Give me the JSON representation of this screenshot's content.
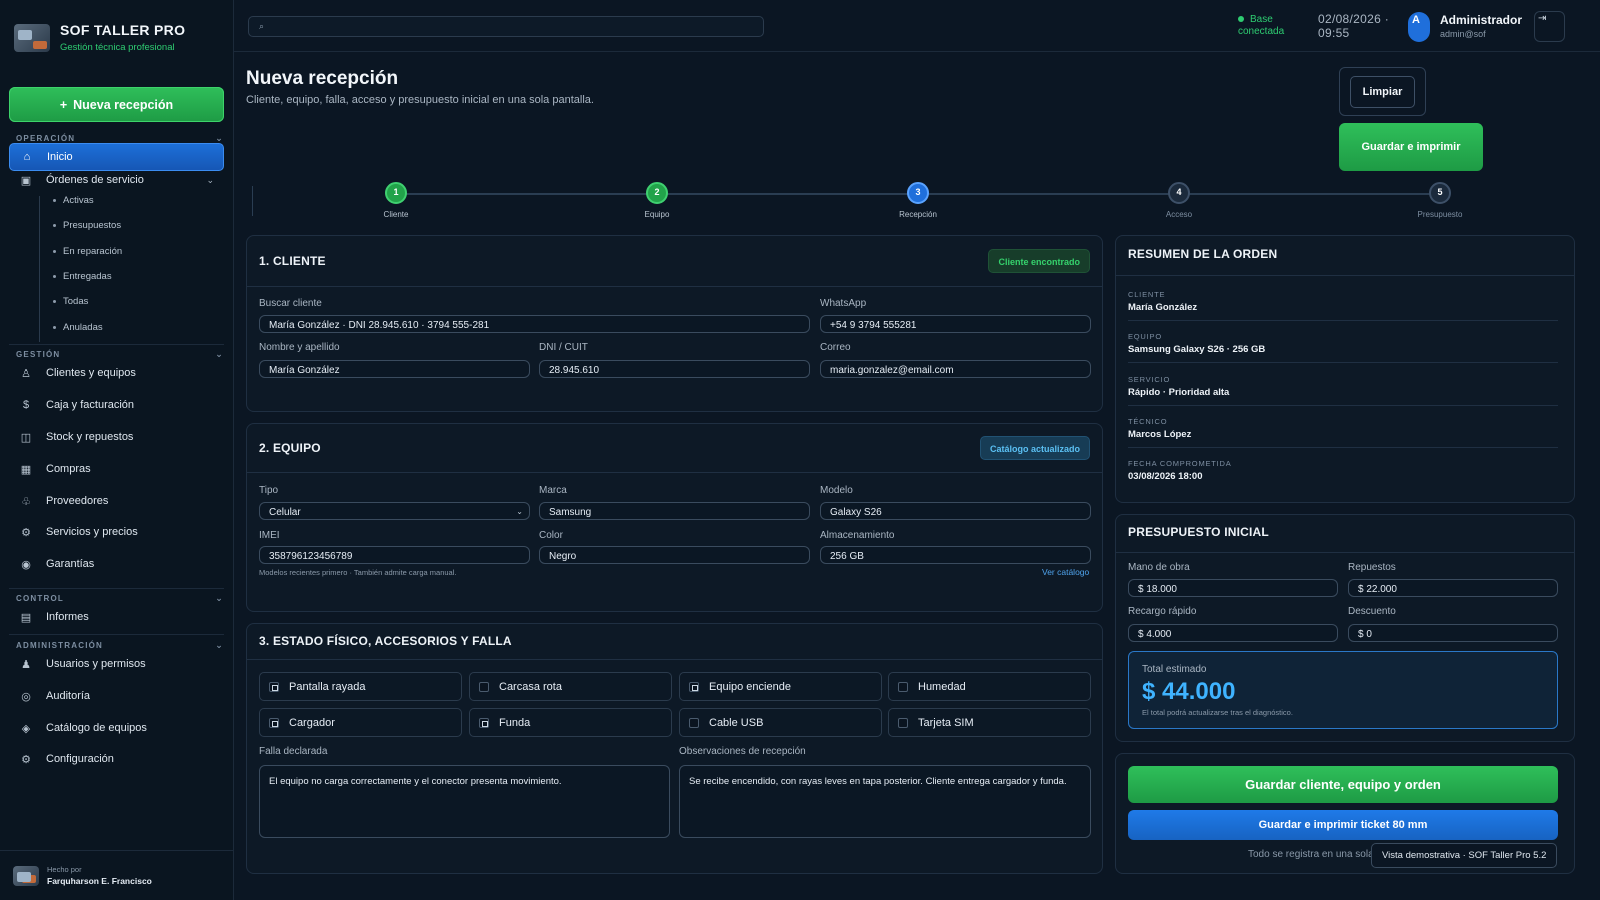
{
  "brand": {
    "title": "SOF TALLER PRO",
    "subtitle": "Gestión técnica profesional"
  },
  "sidebar": {
    "new_button": "Nueva recepción",
    "new_button_icon": "+",
    "sections": {
      "operacion": "OPERACIÓN",
      "gestion": "GESTIÓN",
      "control": "CONTROL",
      "administracion": "ADMINISTRACIÓN"
    },
    "items": {
      "inicio": "Inicio",
      "ordenes": "Órdenes de servicio",
      "clientes": "Clientes y equipos",
      "caja": "Caja y facturación",
      "stock": "Stock y repuestos",
      "compras": "Compras",
      "proveedores": "Proveedores",
      "servicios": "Servicios y precios",
      "garantias": "Garantías",
      "informes": "Informes",
      "usuarios": "Usuarios y permisos",
      "auditoria": "Auditoría",
      "catalogo": "Catálogo de equipos",
      "configuracion": "Configuración"
    },
    "sub_items": [
      "Activas",
      "Presupuestos",
      "En reparación",
      "Entregadas",
      "Todas",
      "Anuladas"
    ],
    "footer": {
      "small": "Hecho por",
      "name": "Farquharson E. Francisco"
    }
  },
  "topbar": {
    "search_icon": "⌕",
    "status_line1": "Base",
    "status_line2": "conectada",
    "date": "02/08/2026 ·",
    "time": "09:55",
    "avatar": "A",
    "user_name": "Administrador",
    "user_email": "admin@sof",
    "logout_icon": "⇥"
  },
  "page": {
    "title": "Nueva recepción",
    "subtitle": "Cliente, equipo, falla, acceso y presupuesto inicial en una sola pantalla.",
    "clear_button": "Limpiar",
    "save_print_button": "Guardar e imprimir"
  },
  "stepper": {
    "steps": [
      {
        "num": "1",
        "label": "Cliente"
      },
      {
        "num": "2",
        "label": "Equipo"
      },
      {
        "num": "3",
        "label": "Recepción"
      },
      {
        "num": "4",
        "label": "Acceso"
      },
      {
        "num": "5",
        "label": "Presupuesto"
      }
    ],
    "current_step": 3
  },
  "cliente": {
    "title": "1. CLIENTE",
    "badge": "Cliente encontrado",
    "buscar_label": "Buscar cliente",
    "buscar_value": "María González · DNI 28.945.610 · 3794 555-281",
    "whatsapp_label": "WhatsApp",
    "whatsapp_value": "+54 9 3794 555281",
    "nombre_label": "Nombre y apellido",
    "nombre_value": "María González",
    "dni_label": "DNI / CUIT",
    "dni_value": "28.945.610",
    "correo_label": "Correo",
    "correo_value": "maria.gonzalez@email.com"
  },
  "equipo": {
    "title": "2. EQUIPO",
    "badge": "Catálogo actualizado",
    "tipo_label": "Tipo",
    "tipo_value": "Celular",
    "marca_label": "Marca",
    "marca_value": "Samsung",
    "modelo_label": "Modelo",
    "modelo_value": "Galaxy S26",
    "imei_label": "IMEI",
    "imei_value": "358796123456789",
    "color_label": "Color",
    "color_value": "Negro",
    "almac_label": "Almacenamiento",
    "almac_value": "256 GB",
    "hint": "Modelos recientes primero · También admite carga manual.",
    "link": "Ver catálogo"
  },
  "estado": {
    "title": "3. ESTADO FÍSICO, ACCESORIOS Y FALLA",
    "checks": [
      {
        "label": "Pantalla rayada",
        "checked": true
      },
      {
        "label": "Carcasa rota",
        "checked": false
      },
      {
        "label": "Equipo enciende",
        "checked": true
      },
      {
        "label": "Humedad",
        "checked": false
      },
      {
        "label": "Cargador",
        "checked": true
      },
      {
        "label": "Funda",
        "checked": true
      },
      {
        "label": "Cable USB",
        "checked": false
      },
      {
        "label": "Tarjeta SIM",
        "checked": false
      }
    ],
    "falla_label": "Falla declarada",
    "falla_value": "El equipo no carga correctamente y el conector presenta movimiento.",
    "obs_label": "Observaciones de recepción",
    "obs_value": "Se recibe encendido, con rayas leves en tapa posterior. Cliente entrega cargador y funda."
  },
  "resumen": {
    "title": "RESUMEN DE LA ORDEN",
    "rows": [
      {
        "key": "CLIENTE",
        "value": "María González"
      },
      {
        "key": "EQUIPO",
        "value": "Samsung Galaxy S26 · 256 GB"
      },
      {
        "key": "SERVICIO",
        "value": "Rápido · Prioridad alta"
      },
      {
        "key": "TÉCNICO",
        "value": "Marcos López"
      },
      {
        "key": "FECHA COMPROMETIDA",
        "value": "03/08/2026 18:00"
      }
    ]
  },
  "presupuesto": {
    "title": "PRESUPUESTO INICIAL",
    "mano_label": "Mano de obra",
    "mano_value": "$ 18.000",
    "repuestos_label": "Repuestos",
    "repuestos_value": "$ 22.000",
    "recargo_label": "Recargo rápido",
    "recargo_value": "$ 4.000",
    "descuento_label": "Descuento",
    "descuento_value": "$ 0",
    "total_label": "Total estimado",
    "total_value": "$ 44.000",
    "total_note": "El total podrá actualizarse tras el diagnóstico."
  },
  "actions": {
    "save_all": "Guardar cliente, equipo y orden",
    "save_print_ticket": "Guardar e imprimir ticket 80 mm",
    "note": "Todo se registra en una sola",
    "demo": "Vista demostrativa · SOF Taller Pro 5.2"
  },
  "colors": {
    "accent_green": "#2fbf5a",
    "accent_blue": "#1f6fdb",
    "background": "#0b1623"
  }
}
